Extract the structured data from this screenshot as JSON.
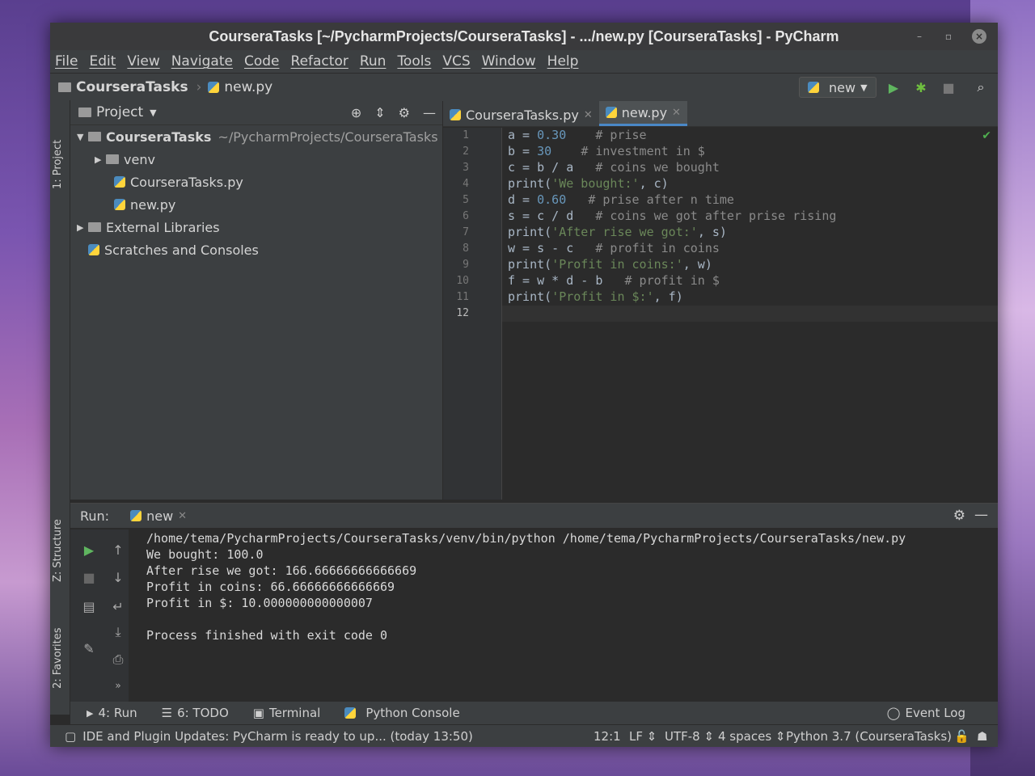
{
  "window": {
    "title": "CourseraTasks [~/PycharmProjects/CourseraTasks] - .../new.py [CourseraTasks] - PyCharm"
  },
  "menu": [
    "File",
    "Edit",
    "View",
    "Navigate",
    "Code",
    "Refactor",
    "Run",
    "Tools",
    "VCS",
    "Window",
    "Help"
  ],
  "navbar": {
    "project": "CourseraTasks",
    "file": "new.py",
    "run_config": "new"
  },
  "sidebar_tabs": {
    "project": "1: Project",
    "structure": "Z: Structure",
    "favorites": "2: Favorites"
  },
  "project_panel": {
    "title": "Project",
    "root": "CourseraTasks",
    "root_path": "~/PycharmProjects/CourseraTasks",
    "items": [
      "venv",
      "CourseraTasks.py",
      "new.py",
      "External Libraries",
      "Scratches and Consoles"
    ]
  },
  "editor": {
    "tabs": [
      "CourseraTasks.py",
      "new.py"
    ],
    "line_numbers": [
      "1",
      "2",
      "3",
      "4",
      "5",
      "6",
      "7",
      "8",
      "9",
      "10",
      "11",
      "12"
    ]
  },
  "run_panel": {
    "label": "Run:",
    "config": "new",
    "output": [
      "/home/tema/PycharmProjects/CourseraTasks/venv/bin/python /home/tema/PycharmProjects/CourseraTasks/new.py",
      "We bought: 100.0",
      "After rise we got: 166.66666666666669",
      "Profit in coins: 66.66666666666669",
      "Profit in $: 10.000000000000007",
      "",
      "Process finished with exit code 0"
    ]
  },
  "bottom_tabs": [
    "4: Run",
    "6: TODO",
    "Terminal",
    "Python Console"
  ],
  "event_log": "Event Log",
  "status": {
    "message": "IDE and Plugin Updates: PyCharm is ready to up... (today 13:50)",
    "position": "12:1",
    "line_sep": "LF",
    "encoding": "UTF-8",
    "indent": "4 spaces",
    "interpreter": "Python 3.7 (CourseraTasks)"
  }
}
